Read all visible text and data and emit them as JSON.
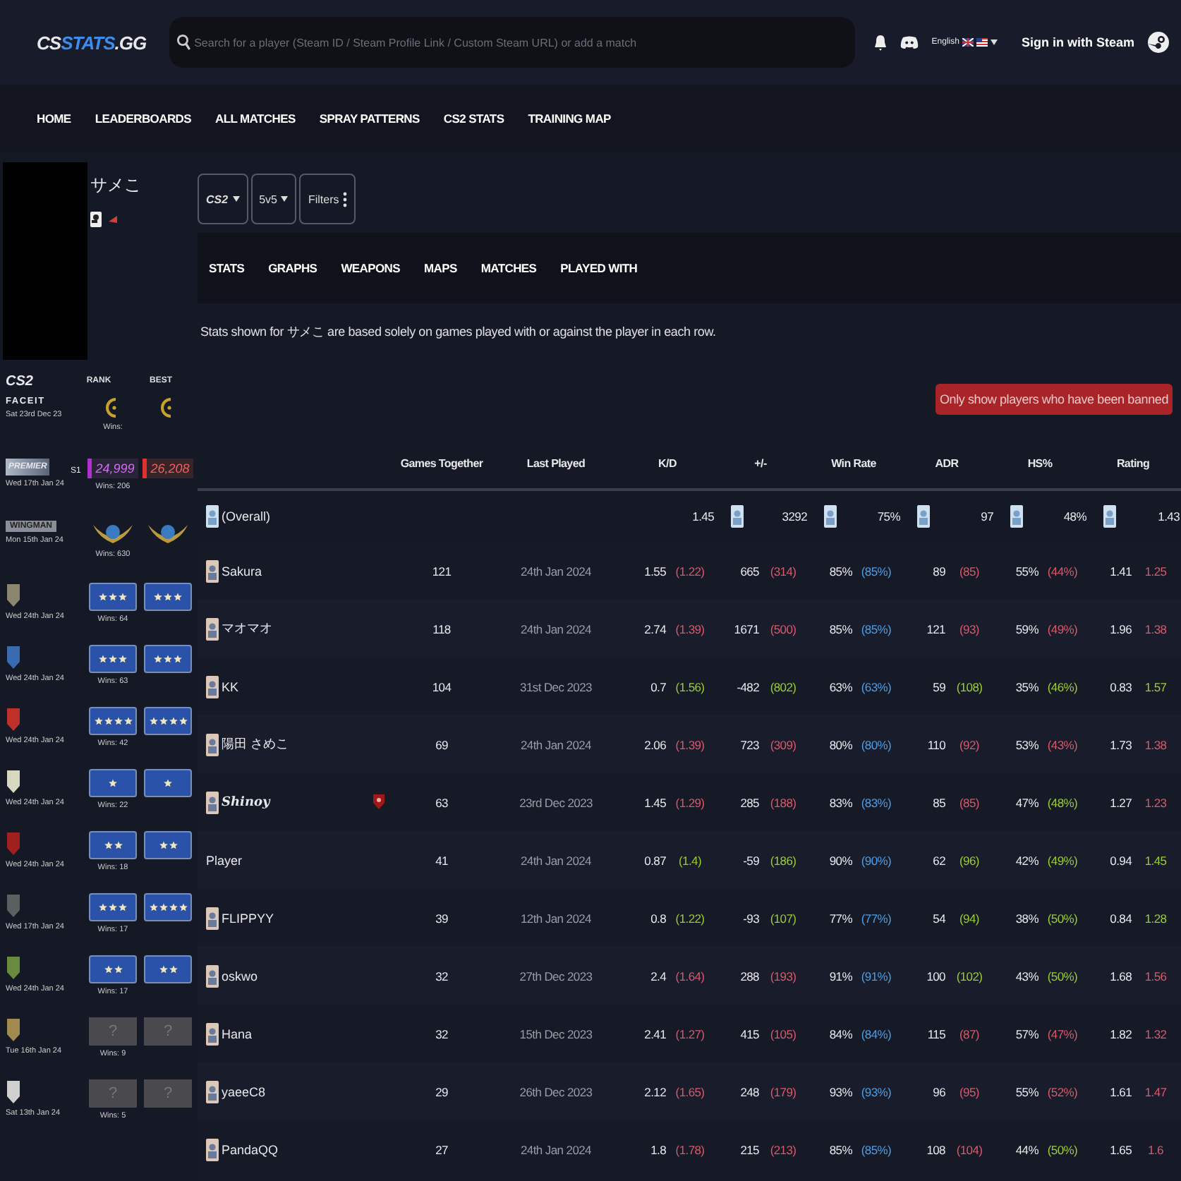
{
  "header": {
    "logo": {
      "lead": "CS",
      "accent": "STATS",
      "tail": ".GG"
    },
    "search": {
      "placeholder": "Search for a player (Steam ID / Steam Profile Link / Custom Steam URL) or add a match"
    },
    "language": "English",
    "sign_in": "Sign in with Steam"
  },
  "nav": [
    "HOME",
    "LEADERBOARDS",
    "ALL MATCHES",
    "SPRAY PATTERNS",
    "CS2 STATS",
    "TRAINING MAP"
  ],
  "profile": {
    "name": "サメこ",
    "ranks_header": {
      "game": "CS2",
      "rank": "RANK",
      "best": "BEST"
    },
    "ranks": [
      {
        "kind": "faceit",
        "label": "FACEIT",
        "date": "Sat 23rd Dec 23",
        "wins": "Wins:"
      },
      {
        "kind": "premier",
        "label": "PREMIER",
        "season": "S1",
        "date": "Wed 17th Jan 24",
        "rank": "24,999",
        "wins": "Wins: 206",
        "best": "26,208"
      },
      {
        "kind": "wingman",
        "label": "WINGMAN",
        "date": "Mon 15th Jan 24",
        "wins": "Wins: 630"
      },
      {
        "kind": "competitive",
        "color": "#8a8670",
        "date": "Wed 24th Jan 24",
        "rank": {
          "kind": "three-star"
        },
        "wins": "Wins: 64",
        "best": {
          "kind": "three-star"
        }
      },
      {
        "kind": "competitive",
        "color": "#3a6ab0",
        "date": "Wed 24th Jan 24",
        "rank": {
          "kind": "three-star"
        },
        "wins": "Wins: 63",
        "best": {
          "kind": "three-star"
        }
      },
      {
        "kind": "competitive",
        "color": "#c0302b",
        "date": "Wed 24th Jan 24",
        "rank": {
          "kind": "four-star"
        },
        "wins": "Wins: 42",
        "best": {
          "kind": "four-star"
        }
      },
      {
        "kind": "competitive",
        "color": "#d8d8c0",
        "date": "Wed 24th Jan 24",
        "rank": {
          "kind": "one-star"
        },
        "wins": "Wins: 22",
        "best": {
          "kind": "one-star"
        }
      },
      {
        "kind": "competitive",
        "color": "#a02020",
        "date": "Wed 24th Jan 24",
        "rank": {
          "kind": "two-star"
        },
        "wins": "Wins: 18",
        "best": {
          "kind": "two-star"
        }
      },
      {
        "kind": "competitive",
        "color": "#5a6060",
        "date": "Wed 17th Jan 24",
        "rank": {
          "kind": "three-star"
        },
        "wins": "Wins: 17",
        "best": {
          "kind": "four-star"
        }
      },
      {
        "kind": "competitive",
        "color": "#6a8a40",
        "date": "Wed 24th Jan 24",
        "rank": {
          "kind": "two-star"
        },
        "wins": "Wins: 17",
        "best": {
          "kind": "two-star"
        }
      },
      {
        "kind": "competitive",
        "color": "#a08a50",
        "date": "Tue 16th Jan 24",
        "rank": {
          "kind": "unknown",
          "text": "?"
        },
        "wins": "Wins: 9",
        "best": {
          "kind": "unknown",
          "text": "?"
        }
      },
      {
        "kind": "competitive",
        "color": "#d0d0d0",
        "date": "Sat 13th Jan 24",
        "rank": {
          "kind": "unknown",
          "text": "?"
        },
        "wins": "Wins: 5",
        "best": {
          "kind": "unknown",
          "text": "?"
        }
      }
    ]
  },
  "filters": [
    "CS2",
    "5v5",
    "Filters"
  ],
  "tabs": [
    "STATS",
    "GRAPHS",
    "WEAPONS",
    "MAPS",
    "MATCHES",
    "PLAYED WITH"
  ],
  "note": "Stats shown for サメこ are based solely on games played with or against the player in each row.",
  "banned_button": "Only show players who have been banned",
  "table": {
    "columns": [
      "Games Together",
      "Last Played",
      "K/D",
      "+/-",
      "Win Rate",
      "ADR",
      "HS%",
      "Rating"
    ],
    "overall": {
      "name": "(Overall)",
      "stats": [
        {
          "value": "1.45",
          "icon": false
        },
        {
          "value": "3292",
          "icon": true
        },
        {
          "value": "75%",
          "icon": true
        },
        {
          "value": "97",
          "icon": true
        },
        {
          "value": "48%",
          "icon": true
        },
        {
          "value": "1.43",
          "icon": true
        }
      ]
    },
    "rows": [
      {
        "name": "Sakura",
        "avatar": true,
        "script": false,
        "badge": false,
        "games": "121",
        "last": "24th Jan 2024",
        "stats": [
          {
            "value": "1.55",
            "compare": "(1.22)",
            "color": "#d9596a"
          },
          {
            "value": "665",
            "compare": "(314)",
            "color": "#d9596a"
          },
          {
            "value": "85%",
            "compare": "(85%)",
            "color": "#4a9fe8"
          },
          {
            "value": "89",
            "compare": "(85)",
            "color": "#d9596a"
          },
          {
            "value": "55%",
            "compare": "(44%)",
            "color": "#d9596a"
          },
          {
            "value": "1.41",
            "compare": "1.25",
            "color": "#d9596a"
          }
        ]
      },
      {
        "name": "マオマオ",
        "avatar": true,
        "script": false,
        "badge": false,
        "games": "118",
        "last": "24th Jan 2024",
        "stats": [
          {
            "value": "2.74",
            "compare": "(1.39)",
            "color": "#d9596a"
          },
          {
            "value": "1671",
            "compare": "(500)",
            "color": "#d9596a"
          },
          {
            "value": "85%",
            "compare": "(85%)",
            "color": "#4a9fe8"
          },
          {
            "value": "121",
            "compare": "(93)",
            "color": "#d9596a"
          },
          {
            "value": "59%",
            "compare": "(49%)",
            "color": "#d9596a"
          },
          {
            "value": "1.96",
            "compare": "1.38",
            "color": "#d9596a"
          }
        ]
      },
      {
        "name": "KK",
        "avatar": true,
        "script": false,
        "badge": false,
        "games": "104",
        "last": "31st Dec 2023",
        "stats": [
          {
            "value": "0.7",
            "compare": "(1.56)",
            "color": "#9acd32"
          },
          {
            "value": "-482",
            "compare": "(802)",
            "color": "#9acd32"
          },
          {
            "value": "63%",
            "compare": "(63%)",
            "color": "#4a9fe8"
          },
          {
            "value": "59",
            "compare": "(108)",
            "color": "#9acd32"
          },
          {
            "value": "35%",
            "compare": "(46%)",
            "color": "#9acd32"
          },
          {
            "value": "0.83",
            "compare": "1.57",
            "color": "#9acd32"
          }
        ]
      },
      {
        "name": "陽田 さめこ",
        "avatar": true,
        "script": false,
        "badge": false,
        "games": "69",
        "last": "24th Jan 2024",
        "stats": [
          {
            "value": "2.06",
            "compare": "(1.39)",
            "color": "#d9596a"
          },
          {
            "value": "723",
            "compare": "(309)",
            "color": "#d9596a"
          },
          {
            "value": "80%",
            "compare": "(80%)",
            "color": "#4a9fe8"
          },
          {
            "value": "110",
            "compare": "(92)",
            "color": "#d9596a"
          },
          {
            "value": "53%",
            "compare": "(43%)",
            "color": "#d9596a"
          },
          {
            "value": "1.73",
            "compare": "1.38",
            "color": "#d9596a"
          }
        ]
      },
      {
        "name": "Shinoy",
        "avatar": true,
        "script": true,
        "badge": true,
        "games": "63",
        "last": "23rd Dec 2023",
        "stats": [
          {
            "value": "1.45",
            "compare": "(1.29)",
            "color": "#d9596a"
          },
          {
            "value": "285",
            "compare": "(188)",
            "color": "#d9596a"
          },
          {
            "value": "83%",
            "compare": "(83%)",
            "color": "#4a9fe8"
          },
          {
            "value": "85",
            "compare": "(85)",
            "color": "#d9596a"
          },
          {
            "value": "47%",
            "compare": "(48%)",
            "color": "#9acd32"
          },
          {
            "value": "1.27",
            "compare": "1.23",
            "color": "#d9596a"
          }
        ]
      },
      {
        "name": "Player",
        "avatar": false,
        "script": false,
        "badge": false,
        "games": "41",
        "last": "24th Jan 2024",
        "stats": [
          {
            "value": "0.87",
            "compare": "(1.4)",
            "color": "#9acd32"
          },
          {
            "value": "-59",
            "compare": "(186)",
            "color": "#9acd32"
          },
          {
            "value": "90%",
            "compare": "(90%)",
            "color": "#4a9fe8"
          },
          {
            "value": "62",
            "compare": "(96)",
            "color": "#9acd32"
          },
          {
            "value": "42%",
            "compare": "(49%)",
            "color": "#9acd32"
          },
          {
            "value": "0.94",
            "compare": "1.45",
            "color": "#9acd32"
          }
        ]
      },
      {
        "name": "FLIPPYY",
        "avatar": true,
        "script": false,
        "badge": false,
        "games": "39",
        "last": "12th Jan 2024",
        "stats": [
          {
            "value": "0.8",
            "compare": "(1.22)",
            "color": "#9acd32"
          },
          {
            "value": "-93",
            "compare": "(107)",
            "color": "#9acd32"
          },
          {
            "value": "77%",
            "compare": "(77%)",
            "color": "#4a9fe8"
          },
          {
            "value": "54",
            "compare": "(94)",
            "color": "#9acd32"
          },
          {
            "value": "38%",
            "compare": "(50%)",
            "color": "#9acd32"
          },
          {
            "value": "0.84",
            "compare": "1.28",
            "color": "#9acd32"
          }
        ]
      },
      {
        "name": "oskwo",
        "avatar": true,
        "script": false,
        "badge": false,
        "games": "32",
        "last": "27th Dec 2023",
        "stats": [
          {
            "value": "2.4",
            "compare": "(1.64)",
            "color": "#d9596a"
          },
          {
            "value": "288",
            "compare": "(193)",
            "color": "#d9596a"
          },
          {
            "value": "91%",
            "compare": "(91%)",
            "color": "#4a9fe8"
          },
          {
            "value": "100",
            "compare": "(102)",
            "color": "#9acd32"
          },
          {
            "value": "43%",
            "compare": "(50%)",
            "color": "#9acd32"
          },
          {
            "value": "1.68",
            "compare": "1.56",
            "color": "#d9596a"
          }
        ]
      },
      {
        "name": "Hana",
        "avatar": true,
        "script": false,
        "badge": false,
        "games": "32",
        "last": "15th Dec 2023",
        "stats": [
          {
            "value": "2.41",
            "compare": "(1.27)",
            "color": "#d9596a"
          },
          {
            "value": "415",
            "compare": "(105)",
            "color": "#d9596a"
          },
          {
            "value": "84%",
            "compare": "(84%)",
            "color": "#4a9fe8"
          },
          {
            "value": "115",
            "compare": "(87)",
            "color": "#d9596a"
          },
          {
            "value": "57%",
            "compare": "(47%)",
            "color": "#d9596a"
          },
          {
            "value": "1.82",
            "compare": "1.32",
            "color": "#d9596a"
          }
        ]
      },
      {
        "name": "yaeeC8",
        "avatar": true,
        "script": false,
        "badge": false,
        "games": "29",
        "last": "26th Dec 2023",
        "stats": [
          {
            "value": "2.12",
            "compare": "(1.65)",
            "color": "#d9596a"
          },
          {
            "value": "248",
            "compare": "(179)",
            "color": "#d9596a"
          },
          {
            "value": "93%",
            "compare": "(93%)",
            "color": "#4a9fe8"
          },
          {
            "value": "96",
            "compare": "(95)",
            "color": "#d9596a"
          },
          {
            "value": "55%",
            "compare": "(52%)",
            "color": "#d9596a"
          },
          {
            "value": "1.61",
            "compare": "1.47",
            "color": "#d9596a"
          }
        ]
      },
      {
        "name": "PandaQQ",
        "avatar": true,
        "script": false,
        "badge": false,
        "games": "27",
        "last": "24th Jan 2024",
        "stats": [
          {
            "value": "1.8",
            "compare": "(1.78)",
            "color": "#d9596a"
          },
          {
            "value": "215",
            "compare": "(213)",
            "color": "#d9596a"
          },
          {
            "value": "85%",
            "compare": "(85%)",
            "color": "#4a9fe8"
          },
          {
            "value": "108",
            "compare": "(104)",
            "color": "#d9596a"
          },
          {
            "value": "44%",
            "compare": "(50%)",
            "color": "#9acd32"
          },
          {
            "value": "1.65",
            "compare": "1.6",
            "color": "#d9596a"
          }
        ]
      }
    ]
  }
}
